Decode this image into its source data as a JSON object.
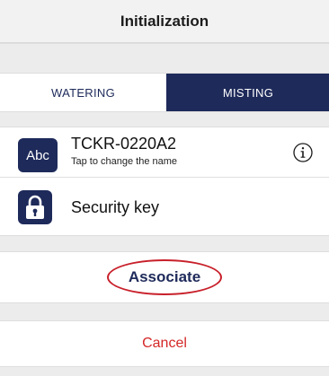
{
  "header": {
    "title": "Initialization"
  },
  "mode_tabs": {
    "watering_label": "WATERING",
    "misting_label": "MISTING",
    "selected": "MISTING"
  },
  "device": {
    "badge_text": "Abc",
    "name": "TCKR-0220A2",
    "hint": "Tap to change the name",
    "info_icon": "info-circle-icon"
  },
  "security": {
    "icon": "lock-icon",
    "label": "Security key"
  },
  "actions": {
    "associate_label": "Associate",
    "cancel_label": "Cancel"
  },
  "colors": {
    "brand_navy": "#1e2a5a",
    "cancel_red": "#d42727",
    "highlight_red": "#c8202a",
    "section_gray": "#ececec"
  }
}
